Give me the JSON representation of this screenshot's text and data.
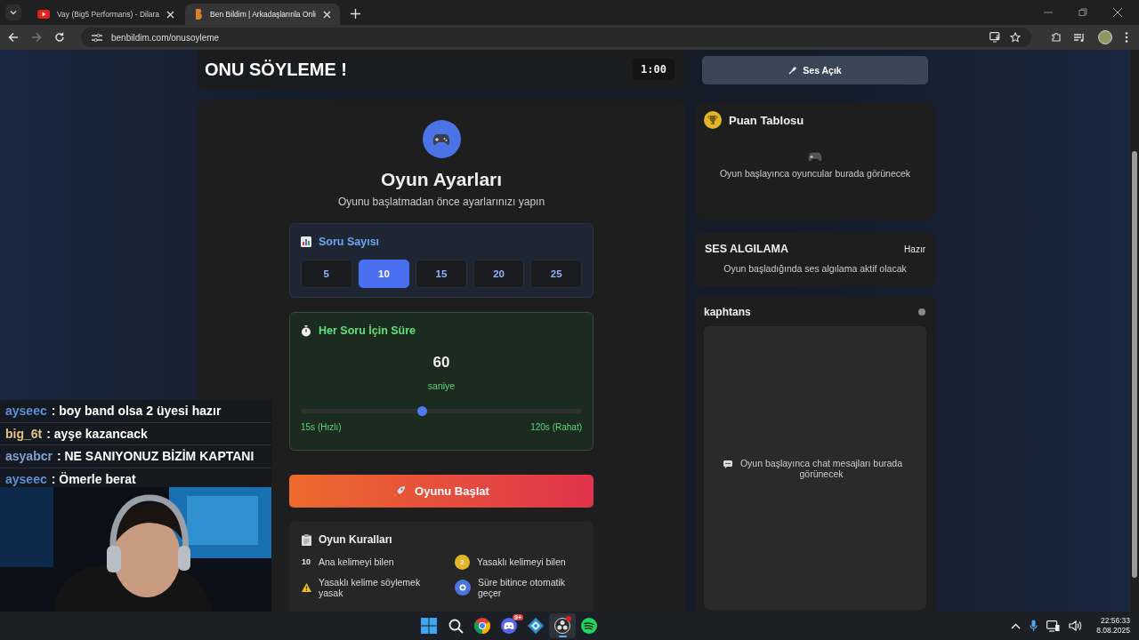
{
  "browser": {
    "tabs": [
      {
        "title": "Vay (Big5 Performans) - Dilara",
        "selected": false
      },
      {
        "title": "Ben Bildim | Arkadaşlarınla Onli",
        "selected": true
      }
    ],
    "address": "benbildim.com/onusoyleme"
  },
  "header": {
    "title": "ONU SÖYLEME !",
    "timer": "1:00"
  },
  "sound_button": {
    "label": "Ses Açık"
  },
  "settings": {
    "title": "Oyun Ayarları",
    "subtitle": "Oyunu başlatmadan önce ayarlarınızı yapın",
    "question_count": {
      "title": "Soru Sayısı",
      "options": [
        {
          "label": "5",
          "selected": false
        },
        {
          "label": "10",
          "selected": true
        },
        {
          "label": "15",
          "selected": false
        },
        {
          "label": "20",
          "selected": false
        },
        {
          "label": "25",
          "selected": false
        }
      ]
    },
    "duration": {
      "title": "Her Soru İçin Süre",
      "value": "60",
      "unit": "saniye",
      "level": 0.43,
      "min_label": "15s (Hızlı)",
      "max_label": "120s (Rahat)"
    },
    "start_button": {
      "label": "Oyunu Başlat"
    },
    "rules": {
      "title": "Oyun Kuralları",
      "items": [
        {
          "kind": "points",
          "badge": "10",
          "text": "Ana kelimeyi bilen"
        },
        {
          "kind": "coin",
          "badge": "2",
          "text": "Yasaklı kelimeyi bilen"
        },
        {
          "kind": "warning",
          "text": "Yasaklı kelime söylemek yasak"
        },
        {
          "kind": "timer",
          "text": "Süre bitince otomatik geçer"
        }
      ]
    }
  },
  "scoreboard": {
    "title": "Puan Tablosu",
    "empty": "Oyun başlayınca oyuncular burada görünecek"
  },
  "voice": {
    "title": "SES ALGILAMA",
    "status": "Hazır",
    "text": "Oyun başladığında ses algılama aktif olacak"
  },
  "chat": {
    "channel": "kaphtans",
    "connected": false,
    "empty": "Oyun başlayınca chat mesajları burada görünecek"
  },
  "stream_chat": [
    {
      "user": "ayseec",
      "color": "#5b8fd6",
      "message": ": boy band olsa 2 üyesi hazır"
    },
    {
      "user": "big_6t",
      "color": "#e2c284",
      "message": ": ayşe kazancack"
    },
    {
      "user": "asyabcr",
      "color": "#7fa3d0",
      "message": ": NE SANIYONUZ BİZİM KAPTANI"
    },
    {
      "user": "ayseec",
      "color": "#5b8fd6",
      "message": ": Ömerle berat"
    }
  ],
  "taskbar": {
    "apps": [
      {
        "kind": "windows",
        "active": false,
        "alert": false
      },
      {
        "kind": "search",
        "active": false,
        "alert": false
      },
      {
        "kind": "chrome",
        "active": false,
        "alert": false
      },
      {
        "kind": "discord",
        "active": false,
        "alert": false,
        "badge": "9+"
      },
      {
        "kind": "cube",
        "active": false,
        "alert": false
      },
      {
        "kind": "obs",
        "active": true,
        "alert": true
      },
      {
        "kind": "spotify",
        "active": false,
        "alert": false
      }
    ],
    "time": "22:56:33",
    "date": "8.08.2025"
  }
}
